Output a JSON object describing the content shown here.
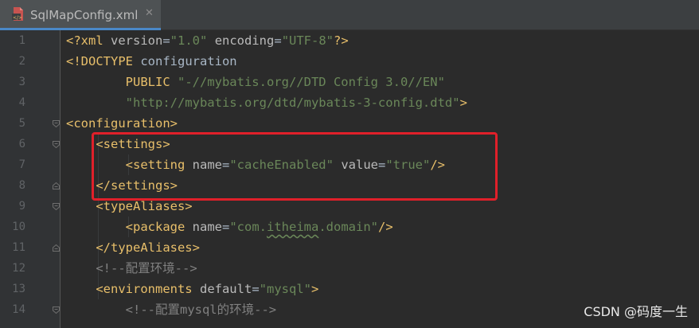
{
  "tab": {
    "filename": "SqlMapConfig.xml",
    "close_glyph": "✕",
    "icon": "xml-file-icon"
  },
  "line_numbers": [
    "1",
    "2",
    "3",
    "4",
    "5",
    "6",
    "7",
    "8",
    "9",
    "10",
    "11",
    "12",
    "13",
    "14"
  ],
  "code": {
    "l1": {
      "p1": "<?xml ",
      "a1": "version",
      "e1": "=",
      "v1": "\"1.0\"",
      "s1": " ",
      "a2": "encoding",
      "e2": "=",
      "v2": "\"UTF-8\"",
      "p2": "?>"
    },
    "l2": {
      "p1": "<!DOCTYPE ",
      "t1": "configuration"
    },
    "l3": {
      "i": "        ",
      "k1": "PUBLIC ",
      "v1": "\"-//mybatis.org//DTD Config 3.0//EN\""
    },
    "l4": {
      "i": "        ",
      "v1": "\"http://mybatis.org/dtd/mybatis-3-config.dtd\"",
      "p1": ">"
    },
    "l5": {
      "t1": "<configuration>"
    },
    "l6": {
      "i": "    ",
      "t1": "<settings>"
    },
    "l7": {
      "i": "        ",
      "t1": "<setting ",
      "a1": "name",
      "e1": "=",
      "v1": "\"cacheEnabled\"",
      "s1": " ",
      "a2": "value",
      "e2": "=",
      "v2": "\"true\"",
      "t2": "/>"
    },
    "l8": {
      "i": "    ",
      "t1": "</settings>"
    },
    "l9": {
      "i": "    ",
      "t1": "<typeAliases>"
    },
    "l10": {
      "i": "        ",
      "t1": "<package ",
      "a1": "name",
      "e1": "=",
      "v1a": "\"com.",
      "v1b": "itheima",
      "v1c": ".domain\"",
      "t2": "/>"
    },
    "l11": {
      "i": "    ",
      "t1": "</typeAliases>"
    },
    "l12": {
      "i": "    ",
      "c1": "<!--配置环境-->"
    },
    "l13": {
      "i": "    ",
      "t1": "<environments ",
      "a1": "default",
      "e1": "=",
      "v1": "\"mysql\"",
      "t2": ">"
    },
    "l14": {
      "i": "        ",
      "c1": "<!--配置mysql的环境-->"
    }
  },
  "watermark": "CSDN @码度一生",
  "colors": {
    "background": "#2B2B2B",
    "tag": "#E8BF6A",
    "attribute": "#BABABA",
    "string": "#6A8759",
    "comment": "#808080",
    "highlight_box": "#E0202A"
  }
}
